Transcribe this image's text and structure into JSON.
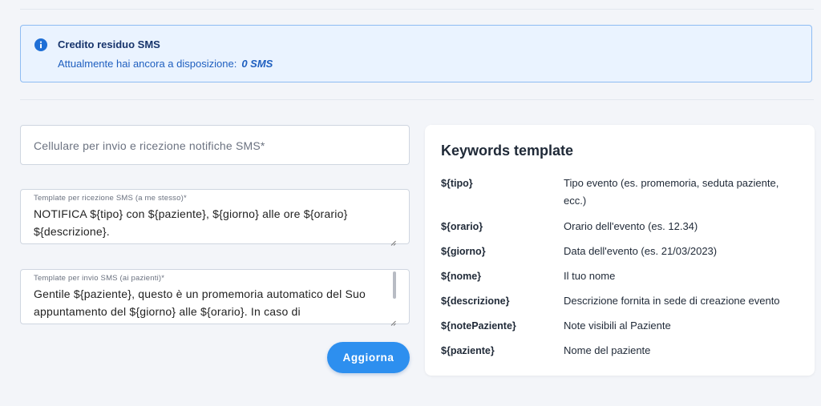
{
  "alert": {
    "title": "Credito residuo SMS",
    "text": "Attualmente hai ancora a disposizione:",
    "value": "0 SMS",
    "icon": "info-icon",
    "accent": "#1f6fd6"
  },
  "form": {
    "phone_placeholder": "Cellulare per invio e ricezione notifiche SMS*",
    "template_self": {
      "label": "Template per ricezione SMS (a me stesso)*",
      "value": "NOTIFICA ${tipo} con ${paziente}, ${giorno} alle ore ${orario} ${descrizione}."
    },
    "template_patients": {
      "label": "Template per invio SMS (ai pazienti)*",
      "value": "Gentile ${paziente}, questo è un promemoria automatico del Suo appuntamento del ${giorno} alle ${orario}. In caso di"
    },
    "submit_label": "Aggiorna"
  },
  "keywords": {
    "title": "Keywords template",
    "items": [
      {
        "key": "${tipo}",
        "desc": "Tipo evento (es. promemoria, seduta paziente, ecc.)"
      },
      {
        "key": "${orario}",
        "desc": "Orario dell'evento (es. 12.34)"
      },
      {
        "key": "${giorno}",
        "desc": "Data dell'evento (es. 21/03/2023)"
      },
      {
        "key": "${nome}",
        "desc": "Il tuo nome"
      },
      {
        "key": "${descrizione}",
        "desc": "Descrizione fornita in sede di creazione evento"
      },
      {
        "key": "${notePaziente}",
        "desc": "Note visibili al Paziente"
      },
      {
        "key": "${paziente}",
        "desc": "Nome del paziente"
      }
    ]
  }
}
